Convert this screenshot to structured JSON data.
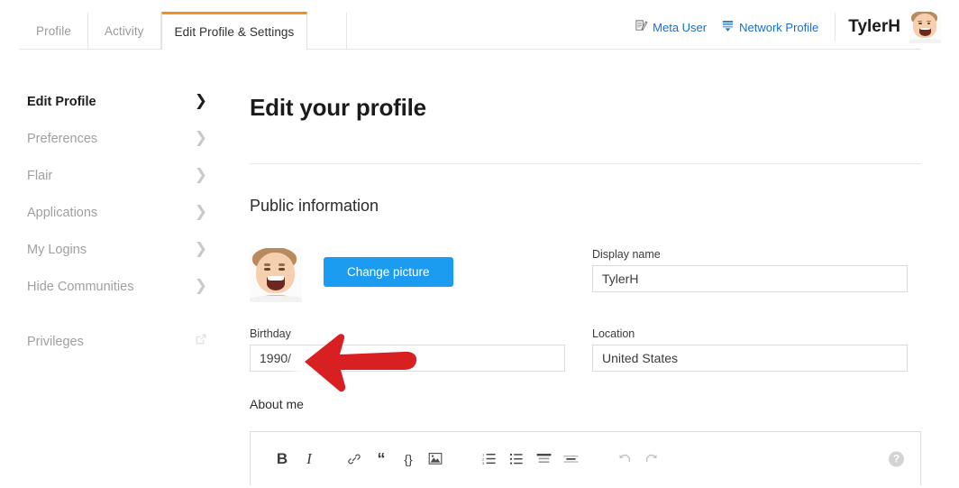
{
  "topbar": {
    "tabs": [
      {
        "label": "Profile",
        "active": false
      },
      {
        "label": "Activity",
        "active": false
      },
      {
        "label": "Edit Profile & Settings",
        "active": true
      }
    ],
    "links": [
      {
        "label": "Meta User",
        "icon": "meta-user-icon"
      },
      {
        "label": "Network Profile",
        "icon": "network-profile-icon"
      }
    ],
    "username": "TylerH",
    "accent_color": "#f4911e",
    "link_color": "#1a6fc4"
  },
  "sidebar": {
    "items": [
      {
        "label": "Edit Profile",
        "active": true,
        "icon": "chevron-right-icon"
      },
      {
        "label": "Preferences",
        "active": false,
        "icon": "chevron-right-icon"
      },
      {
        "label": "Flair",
        "active": false,
        "icon": "chevron-right-icon"
      },
      {
        "label": "Applications",
        "active": false,
        "icon": "chevron-right-icon"
      },
      {
        "label": "My Logins",
        "active": false,
        "icon": "chevron-right-icon"
      },
      {
        "label": "Hide Communities",
        "active": false,
        "icon": "chevron-right-icon"
      }
    ],
    "footer_item": {
      "label": "Privileges",
      "icon": "external-link-icon"
    }
  },
  "main": {
    "page_title": "Edit your profile",
    "section_title": "Public information",
    "change_picture_button": "Change picture",
    "button_color": "#1c9cf0",
    "fields": {
      "display_name": {
        "label": "Display name",
        "value": "TylerH"
      },
      "birthday": {
        "label": "Birthday",
        "value": "1990/"
      },
      "location": {
        "label": "Location",
        "value": "United States"
      }
    },
    "about_me_label": "About me",
    "toolbar": {
      "bold": "B",
      "italic": "I",
      "link": "link-icon",
      "quote": "“",
      "code": "{}",
      "image": "image-icon",
      "ordered_list": "ordered-list-icon",
      "bullet_list": "bullet-list-icon",
      "heading": "heading-icon",
      "hr": "horizontal-rule-icon",
      "undo": "undo-icon",
      "redo": "redo-icon",
      "help": "?"
    }
  },
  "annotation": {
    "type": "arrow",
    "direction": "left",
    "color": "#d81f22",
    "points_at": "birthday-input"
  }
}
